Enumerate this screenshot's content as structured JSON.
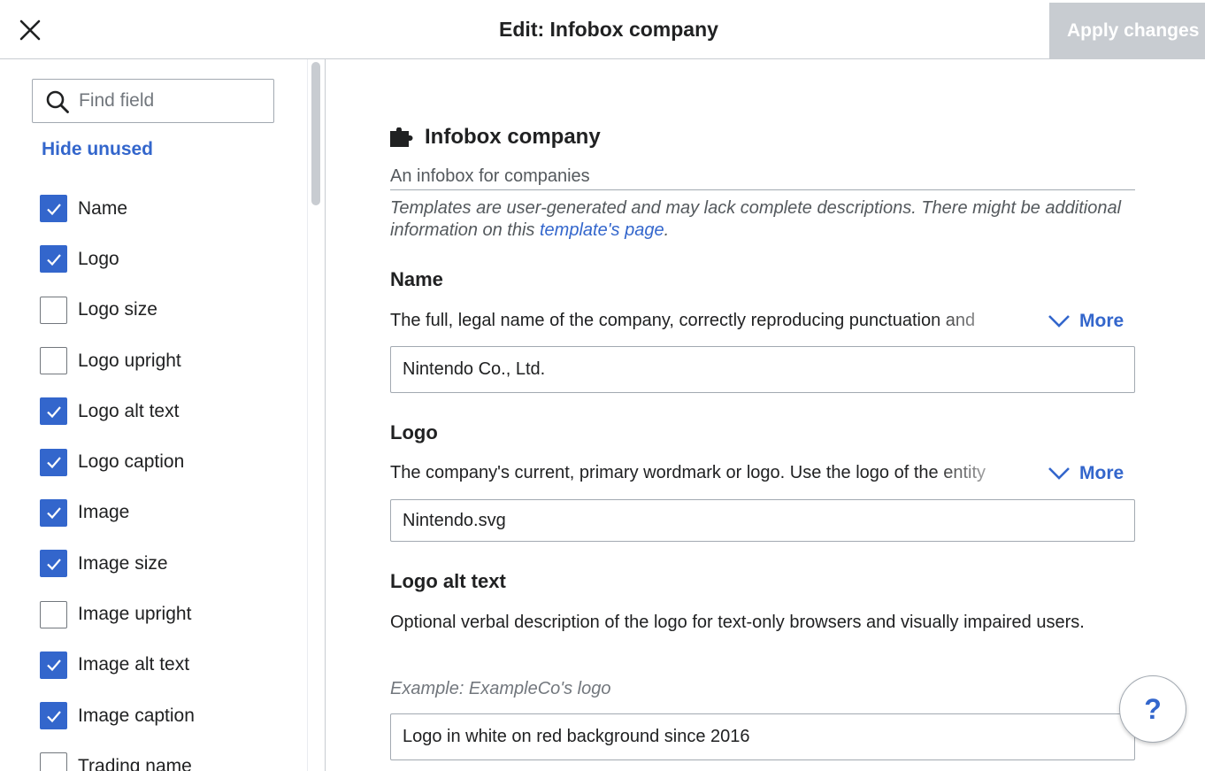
{
  "header": {
    "title": "Edit: Infobox company",
    "apply_label": "Apply changes"
  },
  "sidebar": {
    "search_placeholder": "Find field",
    "hide_unused": "Hide unused",
    "fields": [
      {
        "label": "Name",
        "checked": true
      },
      {
        "label": "Logo",
        "checked": true
      },
      {
        "label": "Logo size",
        "checked": false
      },
      {
        "label": "Logo upright",
        "checked": false
      },
      {
        "label": "Logo alt text",
        "checked": true
      },
      {
        "label": "Logo caption",
        "checked": true
      },
      {
        "label": "Image",
        "checked": true
      },
      {
        "label": "Image size",
        "checked": true
      },
      {
        "label": "Image upright",
        "checked": false
      },
      {
        "label": "Image alt text",
        "checked": true
      },
      {
        "label": "Image caption",
        "checked": true
      },
      {
        "label": "Trading name",
        "checked": false
      }
    ]
  },
  "template": {
    "title": "Infobox company",
    "description": "An infobox for companies",
    "note_before": "Templates are user-generated and may lack complete descriptions. There might be additional information on this ",
    "note_link": "template's page",
    "note_after": "."
  },
  "params": {
    "name": {
      "label": "Name",
      "description": "The full, legal name of the company, correctly reproducing punctuation and",
      "more": "More",
      "value": "Nintendo Co., Ltd."
    },
    "logo": {
      "label": "Logo",
      "description": "The company's current, primary wordmark or logo. Use the logo of the entity",
      "more": "More",
      "value": "Nintendo.svg"
    },
    "logo_alt": {
      "label": "Logo alt text",
      "description": "Optional verbal description of the logo for text-only browsers and visually impaired users.",
      "example": "Example: ExampleCo's logo",
      "value": "Logo in white on red background since 2016"
    }
  },
  "help": {
    "label": "?"
  },
  "colors": {
    "accent": "#3366cc",
    "disabled": "#c8ccd1",
    "border": "#a2a9b1"
  },
  "icons": {
    "close": "close-icon",
    "search": "search-icon",
    "puzzle": "puzzle-icon",
    "chevron": "chevron-down-icon",
    "check": "check-icon"
  }
}
